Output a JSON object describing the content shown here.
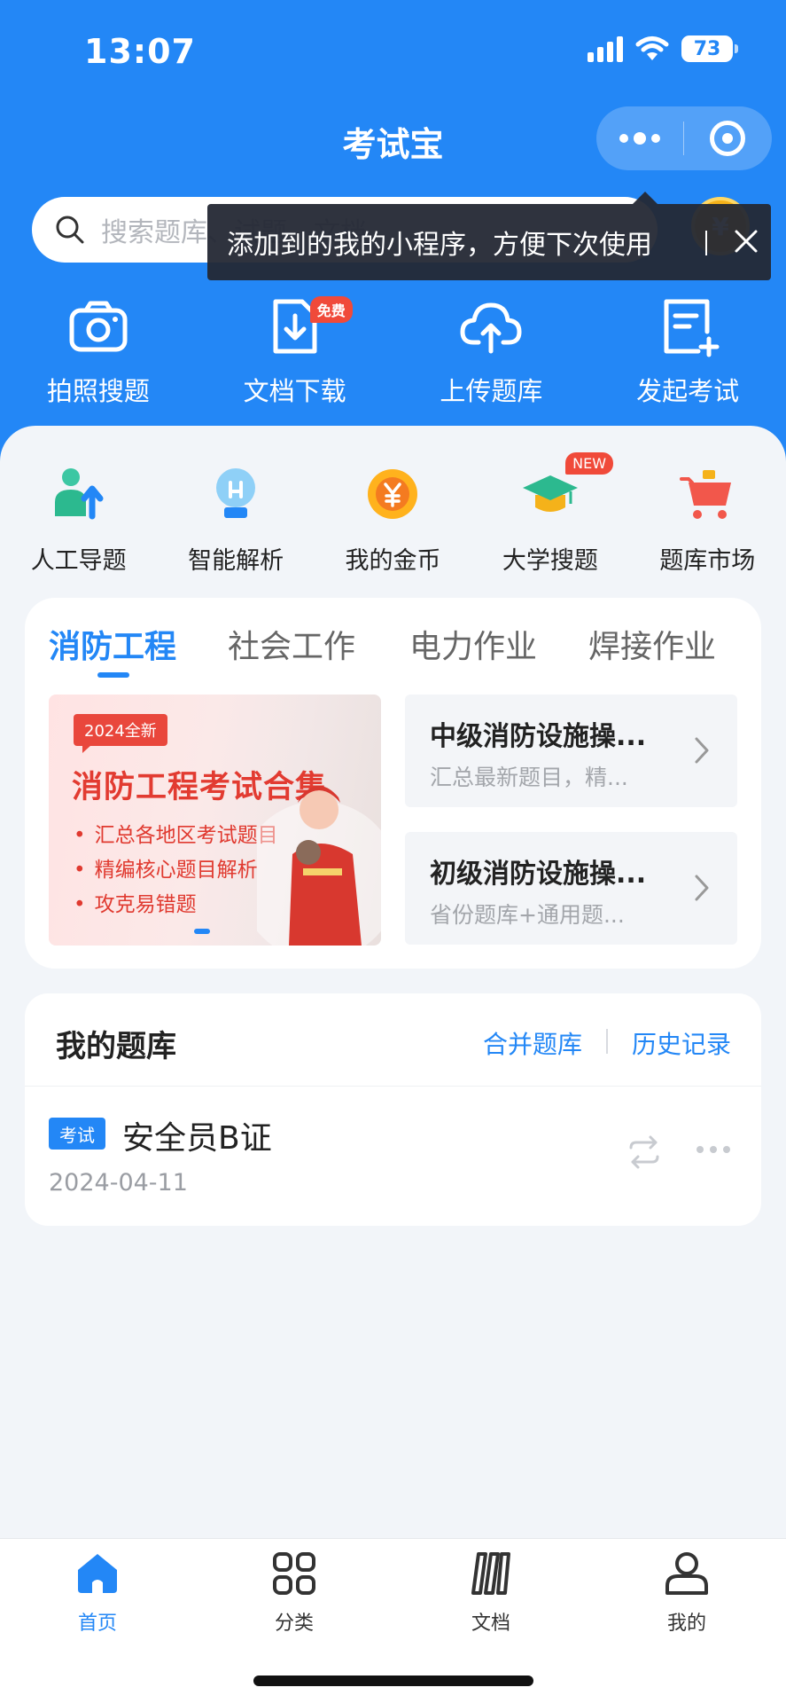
{
  "status_bar": {
    "time": "13:07",
    "battery": "73"
  },
  "header": {
    "title": "考试宝"
  },
  "search": {
    "placeholder": "搜索题库、试题、文档"
  },
  "tooltip": {
    "text": "添加到的我的小程序，方便下次使用"
  },
  "top_actions": [
    {
      "label": "拍照搜题",
      "icon": "camera-icon"
    },
    {
      "label": "文档下载",
      "icon": "download-doc-icon",
      "badge": "免费"
    },
    {
      "label": "上传题库",
      "icon": "cloud-upload-icon"
    },
    {
      "label": "发起考试",
      "icon": "new-exam-icon"
    }
  ],
  "quick_actions": [
    {
      "label": "人工导题",
      "icon": "person-upload-icon"
    },
    {
      "label": "智能解析",
      "icon": "lightbulb-icon"
    },
    {
      "label": "我的金币",
      "icon": "coin-icon"
    },
    {
      "label": "大学搜题",
      "icon": "graduation-cap-icon",
      "badge": "NEW"
    },
    {
      "label": "题库市场",
      "icon": "shopping-cart-icon"
    }
  ],
  "category_tabs": [
    "消防工程",
    "社会工作",
    "电力作业",
    "焊接作业"
  ],
  "banner": {
    "tag": "2024全新",
    "title": "消防工程考试合集",
    "bullets": [
      "汇总各地区考试题目",
      "精编核心题目解析",
      "攻克易错题"
    ]
  },
  "bank_cards": [
    {
      "title": "中级消防设施操...",
      "subtitle": "汇总最新题目，精..."
    },
    {
      "title": "初级消防设施操...",
      "subtitle": "省份题库+通用题..."
    }
  ],
  "my_bank": {
    "title": "我的题库",
    "merge_label": "合并题库",
    "history_label": "历史记录",
    "item": {
      "tag": "考试",
      "name": "安全员B证",
      "date": "2024-04-11"
    }
  },
  "tabbar": [
    {
      "label": "首页",
      "icon": "home-icon",
      "active": true
    },
    {
      "label": "分类",
      "icon": "grid-icon"
    },
    {
      "label": "文档",
      "icon": "books-icon"
    },
    {
      "label": "我的",
      "icon": "user-icon"
    }
  ],
  "colors": {
    "primary": "#2387f6",
    "badge_red": "#f04a3a",
    "banner_red": "#e23b31"
  }
}
